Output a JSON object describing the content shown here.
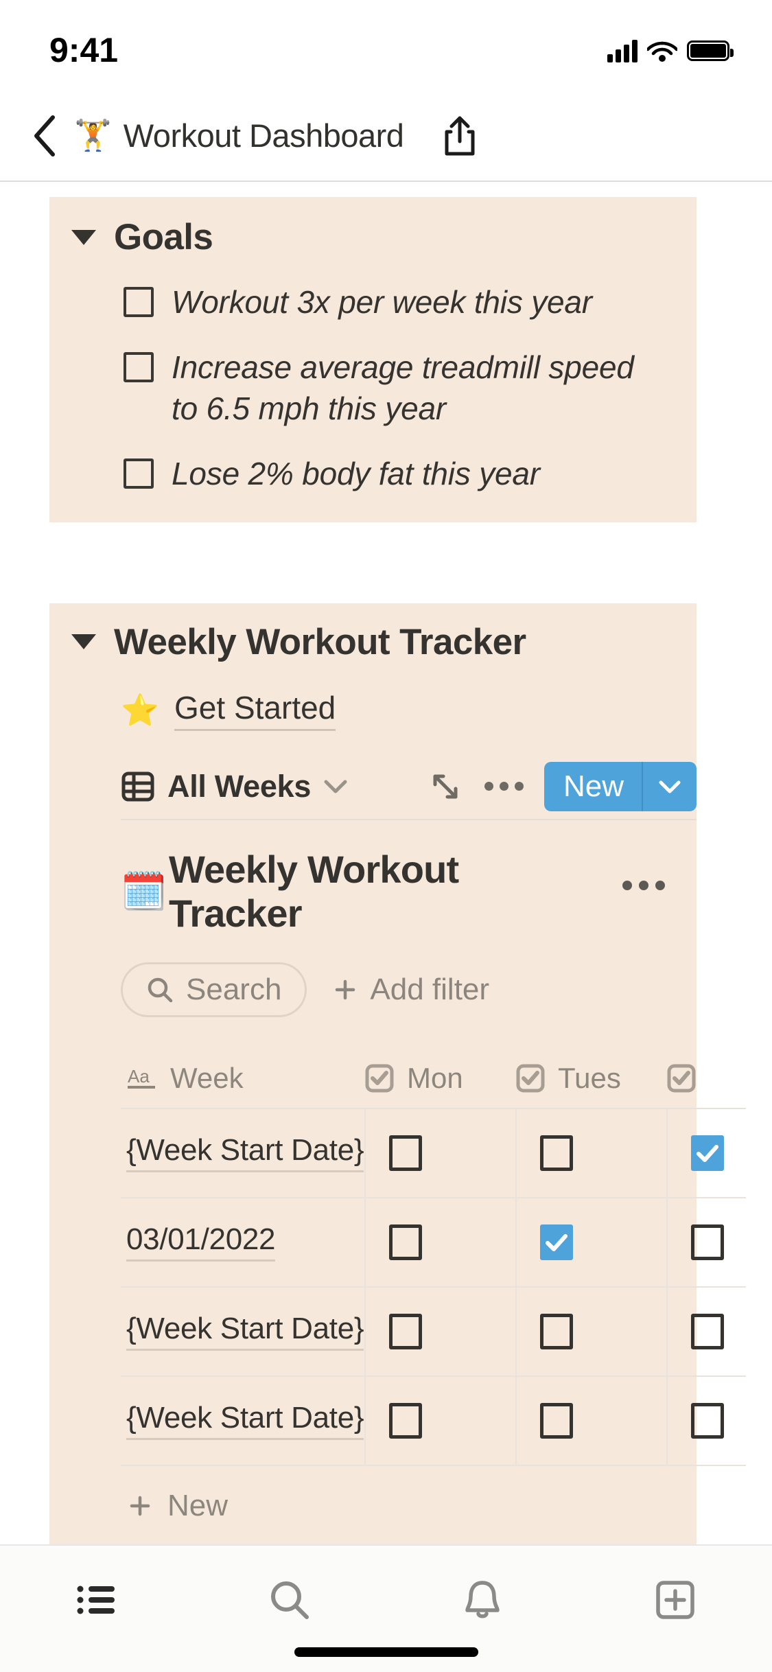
{
  "status_bar": {
    "time": "9:41",
    "signal_icon": "cellular-signal-icon",
    "wifi_icon": "wifi-icon",
    "battery_icon": "battery-icon"
  },
  "nav_bar": {
    "back_icon": "chevron-left-icon",
    "page_emoji": "🏋️",
    "title": "Workout Dashboard",
    "share_icon": "share-icon"
  },
  "goals_block": {
    "toggle_icon": "caret-down-icon",
    "title": "Goals",
    "items": [
      {
        "label": "Workout 3x per week this year",
        "checked": false
      },
      {
        "label": "Increase average treadmill speed to 6.5 mph this year",
        "checked": false
      },
      {
        "label": "Lose 2% body fat this year",
        "checked": false
      }
    ]
  },
  "tracker_block": {
    "toggle_icon": "caret-down-icon",
    "title": "Weekly Workout Tracker",
    "get_started": {
      "emoji": "⭐",
      "label": "Get Started"
    },
    "toolbar": {
      "view_icon": "table-view-icon",
      "view_name": "All Weeks",
      "view_chevron_icon": "chevron-down-icon",
      "expand_icon": "expand-diagonal-icon",
      "more_icon": "ellipsis-icon",
      "new_label": "New",
      "new_dropdown_icon": "chevron-down-icon"
    },
    "database": {
      "emoji": "🗓️",
      "title": "Weekly Workout Tracker",
      "more_icon": "ellipsis-icon",
      "search_placeholder": "Search",
      "search_icon": "search-icon",
      "add_filter_label": "Add filter",
      "add_filter_icon": "plus-icon",
      "columns": [
        {
          "label": "Week",
          "type_icon": "text-type-icon"
        },
        {
          "label": "Mon",
          "type_icon": "checkbox-type-icon"
        },
        {
          "label": "Tues",
          "type_icon": "checkbox-type-icon"
        },
        {
          "label": "",
          "type_icon": "checkbox-type-icon"
        }
      ],
      "rows": [
        {
          "week": "{Week Start Date}",
          "mon": false,
          "tues": false,
          "wed": true
        },
        {
          "week": "03/01/2022",
          "mon": false,
          "tues": true,
          "wed": false
        },
        {
          "week": "{Week Start Date}",
          "mon": false,
          "tues": false,
          "wed": false
        },
        {
          "week": "{Week Start Date}",
          "mon": false,
          "tues": false,
          "wed": false
        }
      ],
      "new_row_label": "New",
      "new_row_icon": "plus-icon"
    }
  },
  "tab_bar": {
    "tabs": [
      {
        "icon": "list-icon",
        "active": true
      },
      {
        "icon": "search-icon",
        "active": false
      },
      {
        "icon": "bell-icon",
        "active": false
      },
      {
        "icon": "plus-square-icon",
        "active": false
      }
    ]
  },
  "colors": {
    "block_background": "#f6e9dc",
    "accent_blue": "#4FA3DB",
    "text_primary": "#35332f",
    "text_muted": "#8d867d",
    "page_background": "#ffffff"
  }
}
